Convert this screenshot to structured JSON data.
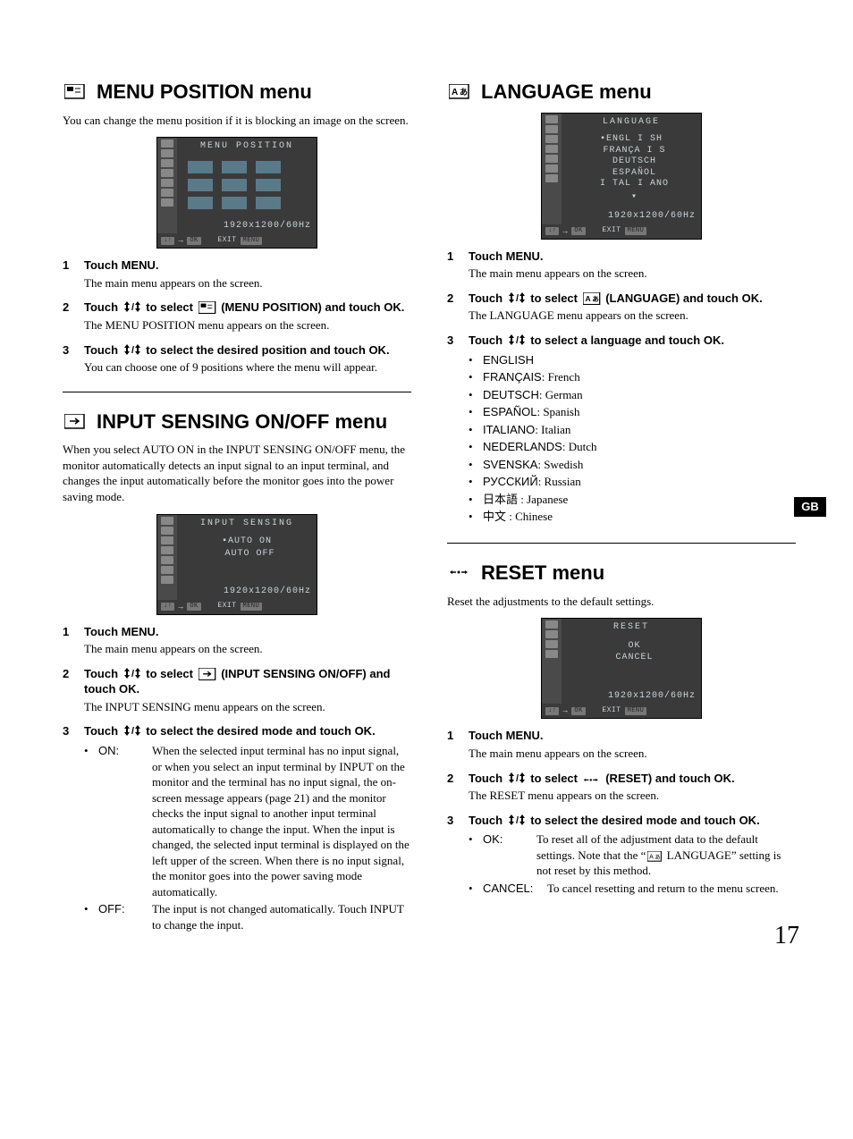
{
  "page": {
    "sideTab": "GB",
    "number": "17"
  },
  "status": "1920x1200/60Hz",
  "footer": {
    "ok": "OK",
    "exit": "EXIT",
    "menu": "MENU"
  },
  "colLeft": {
    "secA": {
      "title": "MENU POSITION menu",
      "intro": "You can change the menu position if it is blocking an image on the screen.",
      "osdTitle": "MENU  POSITION",
      "steps": [
        {
          "head": "Touch MENU.",
          "sub": "The main menu appears on the screen."
        },
        {
          "head_a": "Touch ",
          "head_b": " to select ",
          "head_c": " (MENU POSITION) and touch OK.",
          "sub": "The MENU POSITION menu appears on the screen."
        },
        {
          "head_a": "Touch ",
          "head_b": " to select the desired position and touch OK.",
          "sub": "You can choose one of 9 positions where the menu will appear."
        }
      ]
    },
    "secB": {
      "title": "INPUT SENSING ON/OFF menu",
      "intro": "When you select AUTO ON in the INPUT SENSING ON/OFF menu, the monitor automatically detects an input signal to an input terminal, and changes the input automatically before the monitor goes into the power saving mode.",
      "osdTitle": "INPUT  SENSING",
      "osdLine1": "AUTO  ON",
      "osdLine2": "AUTO  OFF",
      "steps": [
        {
          "head": "Touch MENU.",
          "sub": "The main menu appears on the screen."
        },
        {
          "head_a": "Touch ",
          "head_b": " to select ",
          "head_c": " (INPUT SENSING ON/OFF) and touch OK.",
          "sub": "The INPUT SENSING menu appears on the screen."
        },
        {
          "head_a": "Touch ",
          "head_b": " to select the desired mode and touch OK."
        }
      ],
      "opts": {
        "on": {
          "term": "ON:",
          "desc": "When the selected input terminal has no input signal, or when you select an input terminal by INPUT on the monitor and the terminal has no input signal, the on-screen message appears (page 21) and the monitor checks the input signal to another input terminal automatically to change the input. When the input is changed, the selected input terminal is displayed on the left upper of the screen. When there is no input signal, the monitor goes into the power saving mode automatically."
        },
        "off": {
          "term": "OFF:",
          "desc": "The input is not changed automatically. Touch INPUT to change the input."
        }
      }
    }
  },
  "colRight": {
    "secC": {
      "title": "LANGUAGE menu",
      "osdTitle": "LANGUAGE",
      "osdLangs": [
        "ENGL I SH",
        "FRANÇA I S",
        "DEUTSCH",
        "ESPAÑOL",
        "I TAL I ANO"
      ],
      "steps": [
        {
          "head": "Touch MENU.",
          "sub": "The main menu appears on the screen."
        },
        {
          "head_a": "Touch ",
          "head_b": " to select ",
          "head_c": " (LANGUAGE) and touch OK.",
          "sub": "The LANGUAGE menu appears on the screen."
        },
        {
          "head_a": "Touch ",
          "head_b": " to select a language and touch OK."
        }
      ],
      "langs": [
        {
          "name": "ENGLISH",
          "desc": ""
        },
        {
          "name": "FRANÇAIS",
          "desc": ": French"
        },
        {
          "name": "DEUTSCH",
          "desc": ": German"
        },
        {
          "name": "ESPAÑOL",
          "desc": ": Spanish"
        },
        {
          "name": "ITALIANO",
          "desc": ": Italian"
        },
        {
          "name": "NEDERLANDS",
          "desc": ": Dutch"
        },
        {
          "name": "SVENSKA",
          "desc": ": Swedish"
        },
        {
          "name": "РУССКИЙ",
          "desc": ": Russian"
        },
        {
          "name": "日本語",
          "desc": " : Japanese"
        },
        {
          "name": "中文",
          "desc": " : Chinese"
        }
      ]
    },
    "secD": {
      "title": "RESET menu",
      "intro": "Reset the adjustments to the default settings.",
      "osdTitle": "RESET",
      "osdLine1": "OK",
      "osdLine2": "CANCEL",
      "steps": [
        {
          "head": "Touch MENU.",
          "sub": "The main menu appears on the screen."
        },
        {
          "head_a": "Touch ",
          "head_b": " to select ",
          "head_c": " (RESET) and touch OK.",
          "sub": "The RESET menu appears on the screen."
        },
        {
          "head_a": "Touch ",
          "head_b": " to select the desired mode and touch OK."
        }
      ],
      "opts": {
        "ok": {
          "term": "OK:",
          "desc_a": "To reset all of the adjustment data to the default settings. Note that the “",
          "desc_b": " LANGUAGE” setting is not reset by this method."
        },
        "cancel": {
          "term": "CANCEL:",
          "desc": "To cancel resetting and return to the menu screen."
        }
      }
    }
  }
}
